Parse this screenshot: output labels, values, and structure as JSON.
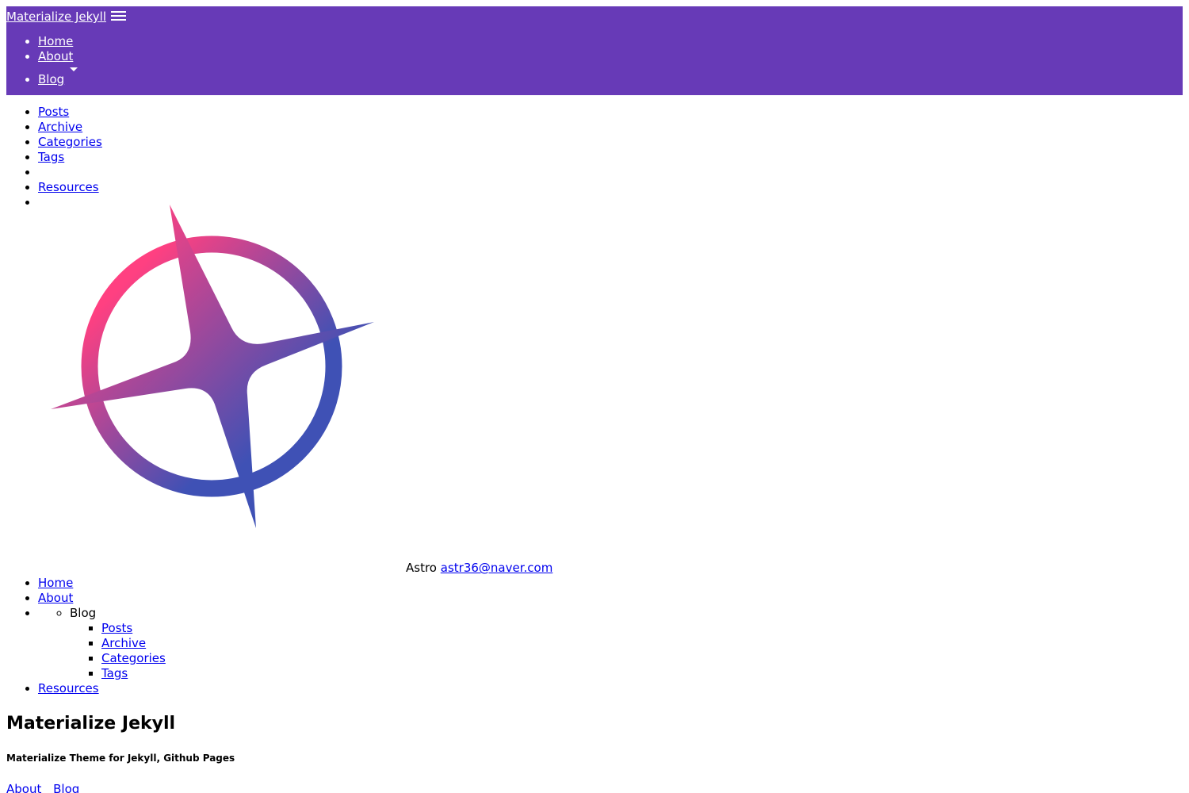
{
  "navbar": {
    "brand": "Materialize Jekyll",
    "menu_icon": "hamburger-menu-icon",
    "background": "#673ab7",
    "items": [
      {
        "label": "Home"
      },
      {
        "label": "About"
      },
      {
        "label": "Blog",
        "icon": "caret-down-icon"
      }
    ]
  },
  "dropdown": {
    "items": [
      {
        "label": "Posts"
      },
      {
        "label": "Archive"
      },
      {
        "label": "Categories"
      },
      {
        "label": "Tags"
      },
      {
        "label": ""
      },
      {
        "label": "Resources"
      }
    ]
  },
  "sidenav": {
    "logo": "astro-compass-star-logo",
    "user_name": "Astro",
    "user_email": "astr36@naver.com",
    "items": [
      {
        "label": "Home"
      },
      {
        "label": "About"
      },
      {
        "label": "Blog"
      },
      {
        "label": "Resources"
      }
    ],
    "blog_sub": [
      {
        "label": "Posts"
      },
      {
        "label": "Archive"
      },
      {
        "label": "Categories"
      },
      {
        "label": "Tags"
      }
    ]
  },
  "header": {
    "title": "Materialize Jekyll",
    "subtitle": "Materialize Theme for Jekyll, Github Pages"
  },
  "footer_links": [
    {
      "label": "About"
    },
    {
      "label": "Blog"
    }
  ],
  "colors": {
    "gradient_start": "#ff4081",
    "gradient_end": "#3f51b5",
    "link": "#0000ee"
  }
}
